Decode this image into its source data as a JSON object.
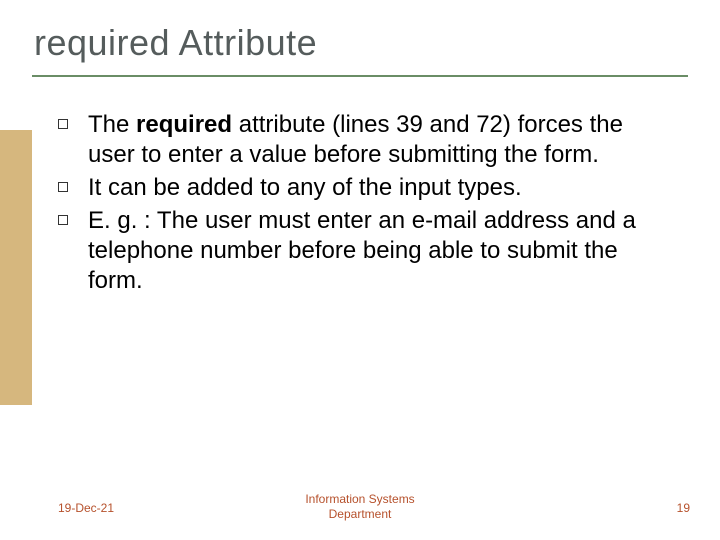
{
  "title": "required Attribute",
  "bullets": [
    {
      "prefix": "The ",
      "strong": "required",
      "suffix": " attribute (lines 39 and 72) forces the user to enter a value before submitting the form."
    },
    {
      "prefix": "",
      "strong": "",
      "suffix": "It can be added to any of the input types."
    },
    {
      "prefix": "",
      "strong": "",
      "suffix": "E. g. : The user must enter an e-mail address and a telephone number before being able to submit the form."
    }
  ],
  "footer": {
    "date": "19-Dec-21",
    "center_line1": "Information Systems",
    "center_line2": "Department",
    "page": "19"
  }
}
